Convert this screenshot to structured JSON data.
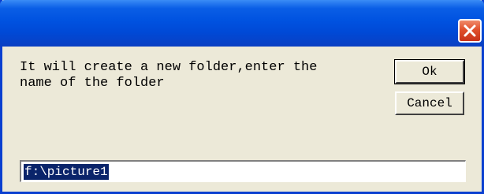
{
  "dialog": {
    "title": "",
    "message": "It will create a new folder,enter the\nname of the folder",
    "ok_label": "Ok",
    "cancel_label": "Cancel",
    "input_value": "f:\\picture1"
  },
  "icons": {
    "close": "close-icon"
  },
  "colors": {
    "titlebar": "#0052e0",
    "close_button": "#e0502c",
    "background": "#ece9d8",
    "selection": "#0a246a"
  }
}
